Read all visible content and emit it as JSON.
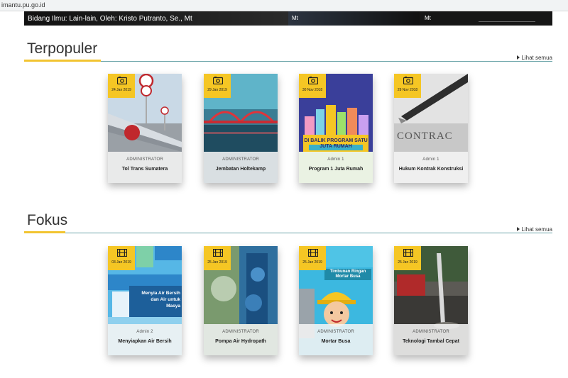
{
  "browser": {
    "url": "imantu.pu.go.id"
  },
  "top_strip": {
    "text1": "Bidang Ilmu: Lain-lain, Oleh: Kristo Putranto, Se., Mt",
    "text2": "Mt",
    "text3": "Mt"
  },
  "sections": {
    "popular": {
      "title": "Terpopuler",
      "see_all": "Lihat semua",
      "cards": [
        {
          "date": "24 Jan 2019",
          "author": "ADMINISTRATOR",
          "title": "Tol Trans Sumatera",
          "icon": "camera-icon"
        },
        {
          "date": "29 Jan 2019",
          "author": "ADMINISTRATOR",
          "title": "Jembatan Holtekamp",
          "icon": "camera-icon"
        },
        {
          "date": "30 Nov 2018",
          "author": "Admin 1",
          "title": "Program 1 Juta Rumah",
          "icon": "camera-icon",
          "image_text": "DI BALIK PROGRAM SATU JUTA RUMAH"
        },
        {
          "date": "29 Nov 2018",
          "author": "Admin 1",
          "title": "Hukum Kontrak Konstruksi",
          "icon": "camera-icon",
          "image_text": "CONTRAC"
        }
      ]
    },
    "focus": {
      "title": "Fokus",
      "see_all": "Lihat semua",
      "cards": [
        {
          "date": "03 Jan 2019",
          "author": "Admin 2",
          "title": "Menyiapkan Air Bersih",
          "icon": "film-icon",
          "image_text": "Menyia Air Bersih dan Air untuk Masya"
        },
        {
          "date": "25 Jan 2019",
          "author": "ADMINISTRATOR",
          "title": "Pompa Air Hydropath",
          "icon": "film-icon"
        },
        {
          "date": "25 Jan 2019",
          "author": "ADMINISTRATOR",
          "title": "Mortar Busa",
          "icon": "film-icon",
          "image_text": "Timbunan Ringan Mortar Busa"
        },
        {
          "date": "25 Jan 2019",
          "author": "ADMINISTRATOR",
          "title": "Teknologi Tambal Cepat",
          "icon": "film-icon"
        }
      ]
    }
  },
  "colors": {
    "accent": "#f2c431",
    "divider": "#6aa3a8",
    "badge": "#f5c624"
  }
}
